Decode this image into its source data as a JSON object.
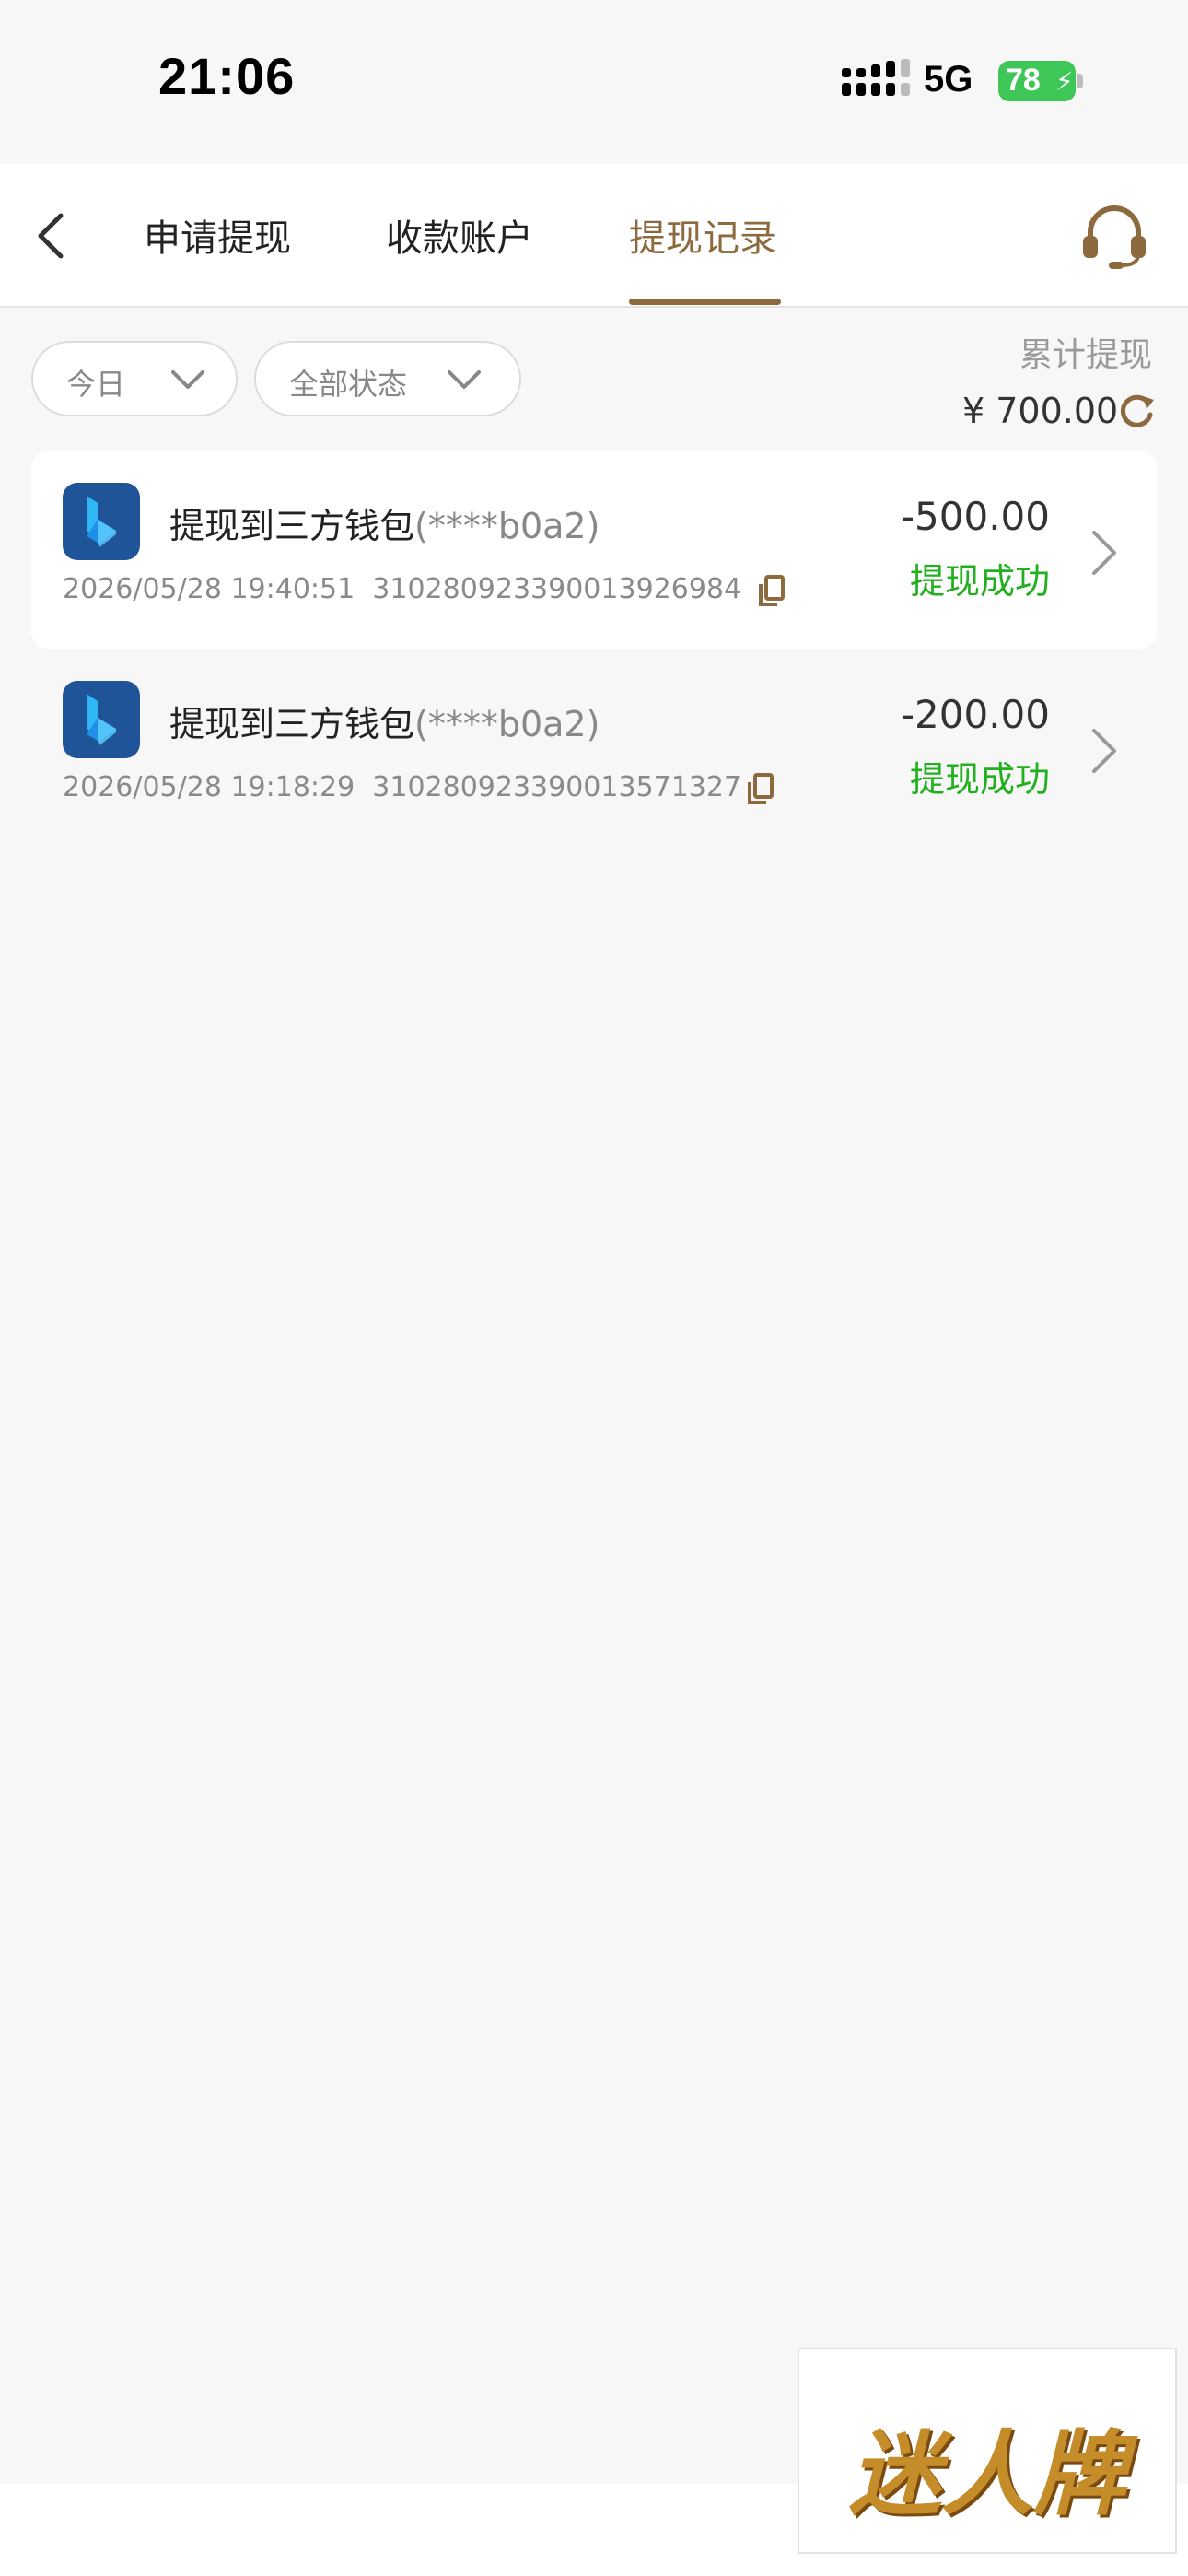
{
  "status_bar": {
    "time": "21:06",
    "network": "5G",
    "battery": "78"
  },
  "nav": {
    "tabs": [
      {
        "label": "申请提现"
      },
      {
        "label": "收款账户"
      },
      {
        "label": "提现记录"
      }
    ],
    "active_tab": 2
  },
  "filters": {
    "date": "今日",
    "status": "全部状态"
  },
  "summary": {
    "label": "累计提现",
    "amount": "¥ 700.00"
  },
  "records": [
    {
      "title": "提现到三方钱包",
      "account": "(****b0a2)",
      "datetime": "2026/05/28 19:40:51",
      "order_no": "310280923390013926984",
      "amount": "-500.00",
      "status": "提现成功"
    },
    {
      "title": "提现到三方钱包",
      "account": "(****b0a2)",
      "datetime": "2026/05/28 19:18:29",
      "order_no": "310280923390013571327",
      "amount": "-200.00",
      "status": "提现成功"
    }
  ],
  "watermark": "迷人牌",
  "colors": {
    "accent": "#8c6a3d",
    "success": "#22b01e",
    "app_icon": "#1f5499",
    "battery": "#3ec657"
  }
}
